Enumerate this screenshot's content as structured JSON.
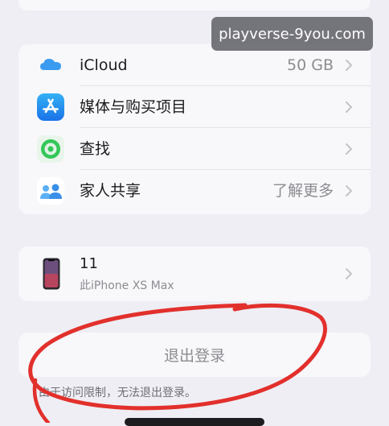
{
  "watermark": {
    "text": "playverse-9you.com"
  },
  "services": {
    "items": [
      {
        "label": "iCloud",
        "value": "50 GB",
        "icon": "icloud-icon"
      },
      {
        "label": "媒体与购买项目",
        "value": "",
        "icon": "app-store-icon"
      },
      {
        "label": "查找",
        "value": "",
        "icon": "find-my-icon"
      },
      {
        "label": "家人共享",
        "value": "了解更多",
        "icon": "family-sharing-icon"
      }
    ]
  },
  "device": {
    "name": "11",
    "model": "此iPhone XS Max",
    "icon": "iphone-icon"
  },
  "signout": {
    "label": "退出登录",
    "note": "由于访问限制，无法退出登录。",
    "annotation_color": "#e2302c"
  },
  "colors": {
    "background": "#efeef5",
    "card": "#f8f8fb",
    "secondary_text": "#8c8c91",
    "icloud_blue": "#3a9bf0",
    "app_store_blue": "#1f8ff0",
    "find_my_green": "#34c759"
  }
}
